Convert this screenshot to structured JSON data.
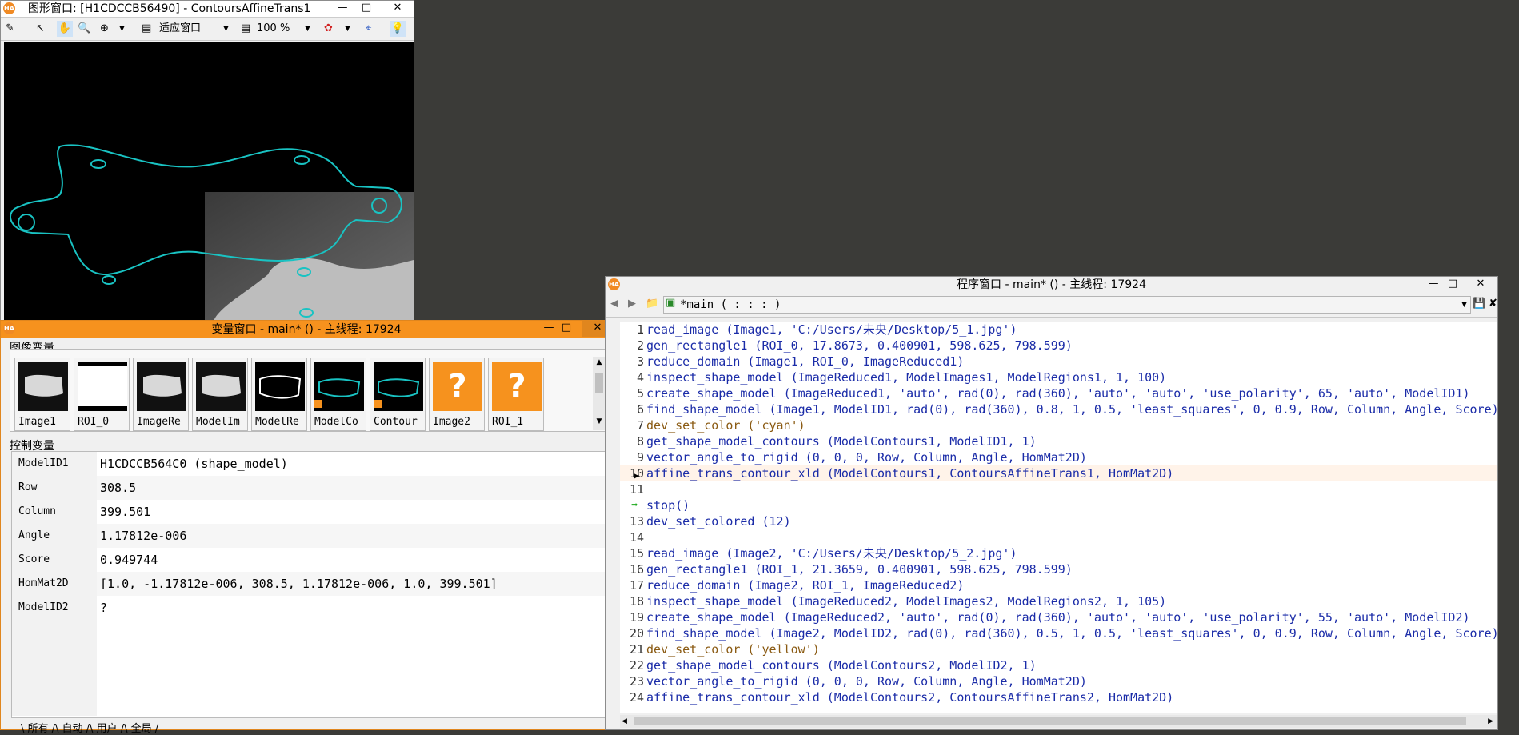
{
  "graphics_window": {
    "title": "图形窗口: [H1CDCCB56490] - ContoursAffineTrans1",
    "fit_label": "适应窗口",
    "zoom_label": "100 %"
  },
  "variable_window": {
    "title": "变量窗口 - main* () - 主线程: 17924",
    "image_section": "图像变量",
    "control_section": "控制变量",
    "thumbs": [
      {
        "label": "Image1",
        "kind": "image"
      },
      {
        "label": "ROI_0",
        "kind": "roi"
      },
      {
        "label": "ImageRe",
        "kind": "image"
      },
      {
        "label": "ModelIm",
        "kind": "image"
      },
      {
        "label": "ModelRe",
        "kind": "region"
      },
      {
        "label": "ModelCo",
        "kind": "contour"
      },
      {
        "label": "Contour",
        "kind": "contour"
      },
      {
        "label": "Image2",
        "kind": "undefined"
      },
      {
        "label": "ROI_1",
        "kind": "undefined"
      }
    ],
    "controls": [
      {
        "name": "ModelID1",
        "value": "H1CDCCB564C0 (shape_model)"
      },
      {
        "name": "Row",
        "value": "308.5"
      },
      {
        "name": "Column",
        "value": "399.501"
      },
      {
        "name": "Angle",
        "value": "1.17812e-006"
      },
      {
        "name": "Score",
        "value": "0.949744"
      },
      {
        "name": "HomMat2D",
        "value": "[1.0, -1.17812e-006, 308.5, 1.17812e-006, 1.0, 399.501]"
      },
      {
        "name": "ModelID2",
        "value": "?"
      }
    ],
    "tabs": "\\ 所有 /\\ 自动 /\\ 用户 /\\ 全局 /"
  },
  "program_window": {
    "title": "程序窗口 - main* () - 主线程: 17924",
    "procedure": "*main ( : : : )",
    "lines": [
      {
        "n": "1",
        "code": "read_image (Image1, 'C:/Users/未央/Desktop/5_1.jpg')"
      },
      {
        "n": "2",
        "code": "gen_rectangle1 (ROI_0, 17.8673, 0.400901, 598.625, 798.599)"
      },
      {
        "n": "3",
        "code": "reduce_domain (Image1, ROI_0, ImageReduced1)"
      },
      {
        "n": "4",
        "code": "inspect_shape_model (ImageReduced1, ModelImages1, ModelRegions1, 1, 100)"
      },
      {
        "n": "5",
        "code": "create_shape_model (ImageReduced1, 'auto', rad(0), rad(360), 'auto', 'auto', 'use_polarity', 65, 'auto', ModelID1)"
      },
      {
        "n": "6",
        "code": "find_shape_model (Image1, ModelID1, rad(0), rad(360), 0.8, 1, 0.5, 'least_squares', 0, 0.9, Row, Column, Angle, Score)"
      },
      {
        "n": "7",
        "code": "dev_set_color ('cyan')"
      },
      {
        "n": "8",
        "code": "get_shape_model_contours (ModelContours1, ModelID1, 1)"
      },
      {
        "n": "9",
        "code": "vector_angle_to_rigid (0, 0, 0, Row, Column, Angle, HomMat2D)"
      },
      {
        "n": "10",
        "code": "affine_trans_contour_xld (ModelContours1, ContoursAffineTrans1, HomMat2D)"
      },
      {
        "n": "11",
        "code": ""
      },
      {
        "n": "",
        "code": "stop()"
      },
      {
        "n": "13",
        "code": "dev_set_colored (12)"
      },
      {
        "n": "14",
        "code": ""
      },
      {
        "n": "15",
        "code": "read_image (Image2, 'C:/Users/未央/Desktop/5_2.jpg')"
      },
      {
        "n": "16",
        "code": "gen_rectangle1 (ROI_1, 21.3659, 0.400901, 598.625, 798.599)"
      },
      {
        "n": "17",
        "code": "reduce_domain (Image2, ROI_1, ImageReduced2)"
      },
      {
        "n": "18",
        "code": "inspect_shape_model (ImageReduced2, ModelImages2, ModelRegions2, 1, 105)"
      },
      {
        "n": "19",
        "code": "create_shape_model (ImageReduced2, 'auto', rad(0), rad(360), 'auto', 'auto', 'use_polarity', 55, 'auto', ModelID2)"
      },
      {
        "n": "20",
        "code": "find_shape_model (Image2, ModelID2, rad(0), rad(360), 0.5, 1, 0.5, 'least_squares', 0, 0.9, Row, Column, Angle, Score)"
      },
      {
        "n": "21",
        "code": "dev_set_color ('yellow')"
      },
      {
        "n": "22",
        "code": "get_shape_model_contours (ModelContours2, ModelID2, 1)"
      },
      {
        "n": "23",
        "code": "vector_angle_to_rigid (0, 0, 0, Row, Column, Angle, HomMat2D)"
      },
      {
        "n": "24",
        "code": "affine_trans_contour_xld (ModelContours2, ContoursAffineTrans2, HomMat2D)"
      }
    ]
  }
}
